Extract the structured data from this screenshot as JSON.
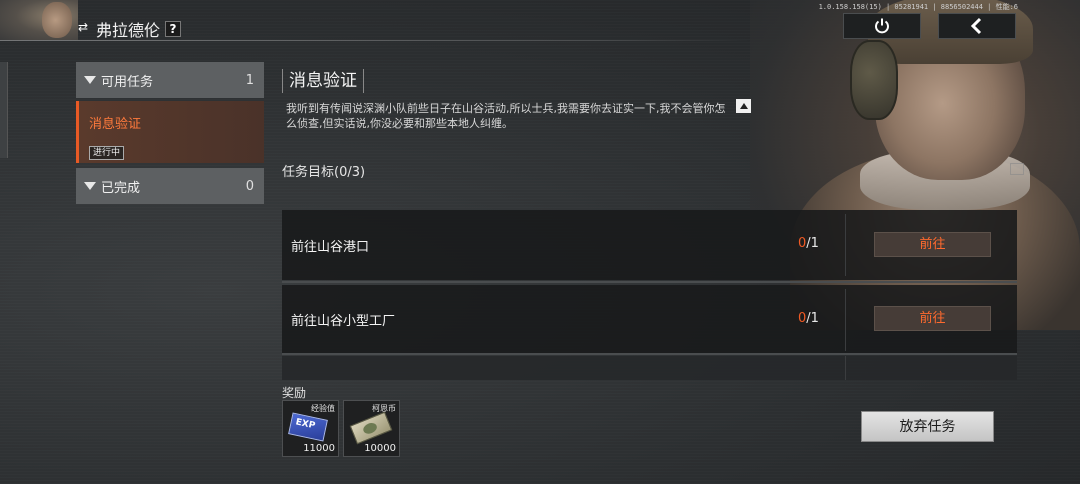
{
  "header": {
    "title": "弗拉德伦",
    "help_label": "?",
    "status_text": "1.0.158.158(15) | 05281941 | 8856502444 | 性能:6",
    "icons": {
      "swap": "swap-icon",
      "power": "power-icon",
      "back": "back-arrow-icon"
    }
  },
  "sidebar": {
    "available": {
      "label": "可用任务",
      "count": "1"
    },
    "active_task": {
      "name": "消息验证",
      "status": "进行中"
    },
    "completed": {
      "label": "已完成",
      "count": "0"
    }
  },
  "quest": {
    "title": "消息验证",
    "description": "我听到有传闻说深渊小队前些日子在山谷活动,所以士兵,我需要你去证实一下,我不会管你怎么侦查,但实话说,你没必要和那些本地人纠缠。",
    "goal_label": "任务目标(0/3)",
    "objectives": [
      {
        "name": "前往山谷港口",
        "current": "0",
        "total": "/1",
        "action": "前往"
      },
      {
        "name": "前往山谷小型工厂",
        "current": "0",
        "total": "/1",
        "action": "前往"
      }
    ]
  },
  "rewards": {
    "label": "奖励",
    "items": [
      {
        "name": "经验值",
        "amount": "11000",
        "icon": "exp-card-icon",
        "icon_text": "EXP"
      },
      {
        "name": "柯恩币",
        "amount": "10000",
        "icon": "cash-icon"
      }
    ]
  },
  "actions": {
    "abandon_label": "放弃任务"
  },
  "colors": {
    "accent": "#f15a24",
    "active_bg": "#4f352b",
    "panel": "#5d6062"
  }
}
